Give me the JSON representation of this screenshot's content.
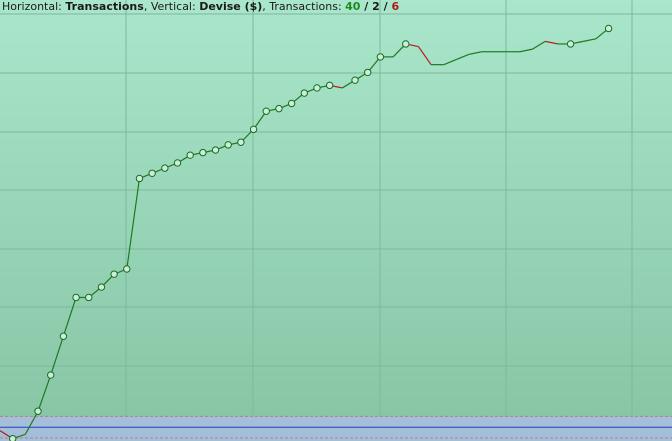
{
  "header": {
    "horizontal_label": "Horizontal:",
    "horizontal_value": "Transactions",
    "vertical_label": "Vertical:",
    "vertical_value": "Devise ($)",
    "transactions_label": "Transactions:",
    "count_win": "40",
    "count_flat": "2",
    "count_loss": "6",
    "sep1": ", ",
    "sep2": ", ",
    "slash": " / "
  },
  "colors": {
    "background_top": "#a9e6cb",
    "background_bottom": "#86c4a4",
    "grid": "#7fb89a",
    "line_up": "#1f7a1f",
    "line_down": "#b21c1c",
    "marker_fill": "#c8efd9",
    "marker_stroke": "#1f6a1f",
    "band_fill": "#a6bedf",
    "band_line": "#2a3fbf"
  },
  "chart_data": {
    "type": "line",
    "xlabel": "Transactions",
    "ylabel": "Devise ($)",
    "grid": true,
    "x": [
      0,
      1,
      2,
      3,
      4,
      5,
      6,
      7,
      8,
      9,
      10,
      11,
      12,
      13,
      14,
      15,
      16,
      17,
      18,
      19,
      20,
      21,
      22,
      23,
      24,
      25,
      26,
      27,
      28,
      29,
      30,
      31,
      32,
      33,
      34,
      35,
      36,
      37,
      38,
      39,
      40,
      41,
      42,
      43,
      44,
      45,
      46,
      47,
      48
    ],
    "y": [
      0.25,
      -0.06,
      0.11,
      1.0,
      2.4,
      3.9,
      5.4,
      5.4,
      5.8,
      6.3,
      6.5,
      10.0,
      10.2,
      10.4,
      10.6,
      10.9,
      11.0,
      11.1,
      11.3,
      11.4,
      11.9,
      12.6,
      12.7,
      12.9,
      13.3,
      13.5,
      13.6,
      13.5,
      13.8,
      14.1,
      14.7,
      14.7,
      15.2,
      15.1,
      14.4,
      14.4,
      14.6,
      14.8,
      14.9,
      14.9,
      14.9,
      14.9,
      15.0,
      15.3,
      15.2,
      15.2,
      15.3,
      15.4,
      15.8
    ],
    "markers": [
      false,
      true,
      false,
      true,
      true,
      true,
      true,
      true,
      true,
      true,
      true,
      true,
      true,
      true,
      true,
      true,
      true,
      true,
      true,
      true,
      true,
      true,
      true,
      true,
      true,
      true,
      true,
      false,
      true,
      true,
      true,
      false,
      true,
      false,
      false,
      false,
      false,
      false,
      false,
      false,
      false,
      false,
      false,
      false,
      false,
      true,
      false,
      false,
      true
    ],
    "ylim": [
      -0.15,
      16.9
    ],
    "xlim": [
      0,
      53
    ],
    "band": [
      -0.15,
      0.8
    ],
    "baseline": 0.38
  }
}
